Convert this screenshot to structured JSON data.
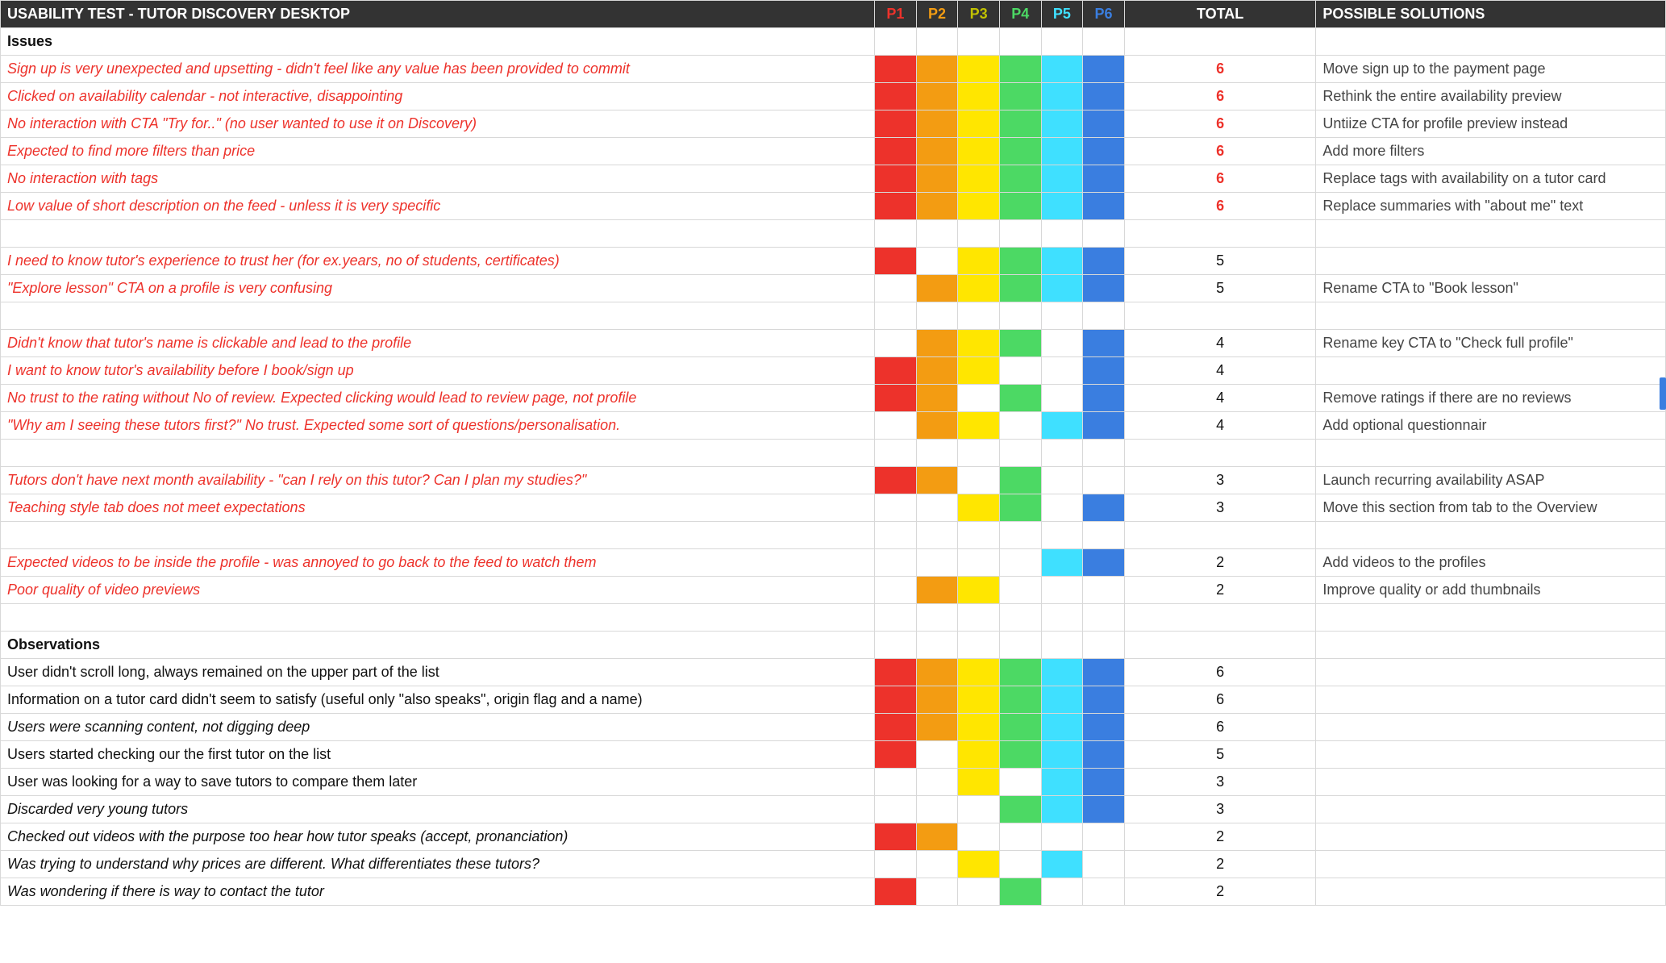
{
  "header": {
    "title": "USABILITY TEST - TUTOR DISCOVERY DESKTOP",
    "p": [
      "P1",
      "P2",
      "P3",
      "P4",
      "P5",
      "P6"
    ],
    "total": "TOTAL",
    "solutions": "POSSIBLE SOLUTIONS"
  },
  "sections": {
    "issues": "Issues",
    "observations": "Observations"
  },
  "rows": [
    {
      "t": "section",
      "key": "issues"
    },
    {
      "t": "issue",
      "desc": "Sign up is very unexpected and upsetting - didn't feel like any value has been provided to commit",
      "p": [
        1,
        1,
        1,
        1,
        1,
        1
      ],
      "total": 6,
      "bold": true,
      "sol": "Move sign up to the payment page"
    },
    {
      "t": "issue",
      "desc": "Clicked on availability calendar - not interactive, disappointing",
      "p": [
        1,
        1,
        1,
        1,
        1,
        1
      ],
      "total": 6,
      "bold": true,
      "sol": "Rethink the entire availability preview"
    },
    {
      "t": "issue",
      "desc": "No interaction with CTA \"Try for..\" (no user wanted to use it on Discovery)",
      "p": [
        1,
        1,
        1,
        1,
        1,
        1
      ],
      "total": 6,
      "bold": true,
      "sol": "Untiize CTA for profile preview instead"
    },
    {
      "t": "issue",
      "desc": "Expected to find more filters than price",
      "p": [
        1,
        1,
        1,
        1,
        1,
        1
      ],
      "total": 6,
      "bold": true,
      "sol": "Add more filters"
    },
    {
      "t": "issue",
      "desc": "No interaction with tags",
      "p": [
        1,
        1,
        1,
        1,
        1,
        1
      ],
      "total": 6,
      "bold": true,
      "sol": "Replace tags with availability on a tutor card"
    },
    {
      "t": "issue",
      "desc": "Low value of short description on the feed - unless it is very specific",
      "p": [
        1,
        1,
        1,
        1,
        1,
        1
      ],
      "total": 6,
      "bold": true,
      "sol": "Replace summaries with \"about me\" text"
    },
    {
      "t": "blank"
    },
    {
      "t": "issue",
      "desc": "I need to know tutor's experience to trust her (for ex.years, no of students, certificates)",
      "p": [
        1,
        0,
        1,
        1,
        1,
        1
      ],
      "total": 5,
      "sol": ""
    },
    {
      "t": "issue",
      "desc": "\"Explore lesson\" CTA on a profile is very confusing",
      "p": [
        0,
        1,
        1,
        1,
        1,
        1
      ],
      "total": 5,
      "sol": "Rename CTA to \"Book lesson\""
    },
    {
      "t": "blank"
    },
    {
      "t": "issue",
      "desc": "Didn't know that tutor's name is clickable and lead to the profile",
      "p": [
        0,
        1,
        1,
        1,
        0,
        1
      ],
      "total": 4,
      "sol": "Rename key CTA to \"Check full profile\""
    },
    {
      "t": "issue",
      "desc": "I want to know tutor's availability before I book/sign up",
      "p": [
        1,
        1,
        1,
        0,
        0,
        1
      ],
      "total": 4,
      "sol": ""
    },
    {
      "t": "issue",
      "desc": "No trust to the rating without No of review. Expected clicking would lead to review page, not profile",
      "p": [
        1,
        1,
        0,
        1,
        0,
        1
      ],
      "total": 4,
      "sol": "Remove ratings if there are no reviews"
    },
    {
      "t": "issue",
      "desc": "\"Why am I seeing these tutors first?\" No trust. Expected some sort of questions/personalisation.",
      "p": [
        0,
        1,
        1,
        0,
        1,
        1
      ],
      "total": 4,
      "sol": "Add optional questionnair"
    },
    {
      "t": "blank"
    },
    {
      "t": "issue",
      "desc": "Tutors don't have next month availability - \"can I rely on this tutor? Can I plan my studies?\"",
      "p": [
        1,
        1,
        0,
        1,
        0,
        0
      ],
      "total": 3,
      "sol": "Launch recurring availability ASAP"
    },
    {
      "t": "issue",
      "desc": "Teaching style tab does not meet expectations",
      "p": [
        0,
        0,
        1,
        1,
        0,
        1
      ],
      "total": 3,
      "sol": "Move this section from tab to the Overview"
    },
    {
      "t": "blank"
    },
    {
      "t": "issue",
      "desc": "Expected videos to be inside the profile - was annoyed to go back to the feed to watch them",
      "p": [
        0,
        0,
        0,
        0,
        1,
        1
      ],
      "total": 2,
      "sol": "Add videos to the profiles"
    },
    {
      "t": "issue",
      "desc": "Poor quality of video previews",
      "p": [
        0,
        1,
        1,
        0,
        0,
        0
      ],
      "total": 2,
      "sol": "Improve quality or add thumbnails"
    },
    {
      "t": "blank"
    },
    {
      "t": "section",
      "key": "observations"
    },
    {
      "t": "obs",
      "style": "normal",
      "desc": "User didn't scroll long, always remained on the upper part of the list",
      "p": [
        1,
        1,
        1,
        1,
        1,
        1
      ],
      "total": 6,
      "sol": ""
    },
    {
      "t": "obs",
      "style": "normal",
      "desc": "Information on a tutor card didn't seem to satisfy (useful only \"also speaks\", origin flag and a name)",
      "p": [
        1,
        1,
        1,
        1,
        1,
        1
      ],
      "total": 6,
      "sol": ""
    },
    {
      "t": "obs",
      "desc": "Users were scanning content, not digging deep",
      "p": [
        1,
        1,
        1,
        1,
        1,
        1
      ],
      "total": 6,
      "sol": ""
    },
    {
      "t": "obs",
      "style": "normal",
      "desc": "Users started checking our the first tutor on the list",
      "p": [
        1,
        0,
        1,
        1,
        1,
        1
      ],
      "total": 5,
      "sol": ""
    },
    {
      "t": "obs",
      "style": "normal",
      "desc": "User was looking for a way to save tutors to compare them later",
      "p": [
        0,
        0,
        1,
        0,
        1,
        1
      ],
      "total": 3,
      "sol": ""
    },
    {
      "t": "obs",
      "desc": "Discarded very young tutors",
      "p": [
        0,
        0,
        0,
        1,
        1,
        1
      ],
      "total": 3,
      "sol": ""
    },
    {
      "t": "obs",
      "desc": "Checked out videos with the purpose too hear how tutor speaks (accept, pronanciation)",
      "p": [
        1,
        1,
        0,
        0,
        0,
        0
      ],
      "total": 2,
      "sol": ""
    },
    {
      "t": "obs",
      "desc": "Was trying to understand why prices are different. What differentiates these tutors?",
      "p": [
        0,
        0,
        1,
        0,
        1,
        0
      ],
      "total": 2,
      "sol": ""
    },
    {
      "t": "obs",
      "desc": "Was wondering if there is way to contact the tutor",
      "p": [
        1,
        0,
        0,
        1,
        0,
        0
      ],
      "total": 2,
      "sol": ""
    }
  ]
}
